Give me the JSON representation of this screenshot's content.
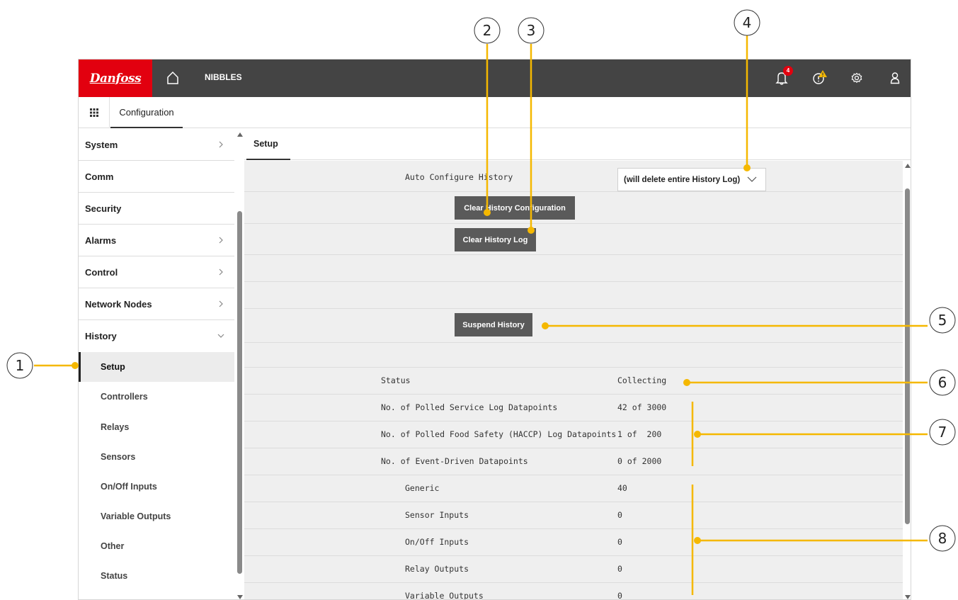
{
  "brand": {
    "logo_text": "Danfoss",
    "accent": "#e2000f",
    "callout_color": "#f5b800"
  },
  "topbar": {
    "app_name": "NIBBLES",
    "icons": [
      "home-icon",
      "bell-icon",
      "alert-icon",
      "gear-icon",
      "user-icon"
    ],
    "notification_count": "4"
  },
  "subbar": {
    "tab_label": "Configuration"
  },
  "sidebar": {
    "items": [
      {
        "label": "System"
      },
      {
        "label": "Comm"
      },
      {
        "label": "Security"
      },
      {
        "label": "Alarms"
      },
      {
        "label": "Control"
      },
      {
        "label": "Network Nodes"
      },
      {
        "label": "History"
      }
    ],
    "sub_items": [
      {
        "label": "Setup"
      },
      {
        "label": "Controllers"
      },
      {
        "label": "Relays"
      },
      {
        "label": "Sensors"
      },
      {
        "label": "On/Off Inputs"
      },
      {
        "label": "Variable Outputs"
      },
      {
        "label": "Other"
      },
      {
        "label": "Status"
      }
    ]
  },
  "content": {
    "tab_label": "Setup",
    "auto_config_label": "Auto Configure History",
    "auto_config_value": "(will delete entire History Log)",
    "clear_config_button": "Clear History Configuration",
    "clear_log_button": "Clear History Log",
    "suspend_button": "Suspend History",
    "status_label": "Status",
    "status_value": "Collecting",
    "stats": [
      {
        "label": "No. of Polled Service Log Datapoints",
        "value": "42 of 3000"
      },
      {
        "label": "No. of Polled Food Safety (HACCP) Log Datapoints",
        "value": "1 of  200"
      },
      {
        "label": "No. of Event-Driven Datapoints",
        "value": "0 of 2000"
      }
    ],
    "event_breakdown": [
      {
        "label": "Generic",
        "value": "40"
      },
      {
        "label": "Sensor Inputs",
        "value": "0"
      },
      {
        "label": "On/Off Inputs",
        "value": "0"
      },
      {
        "label": "Relay Outputs",
        "value": "0"
      },
      {
        "label": "Variable Outputs",
        "value": "0"
      }
    ]
  },
  "callouts": {
    "numbers": [
      "1",
      "2",
      "3",
      "4",
      "5",
      "6",
      "7",
      "8"
    ]
  }
}
